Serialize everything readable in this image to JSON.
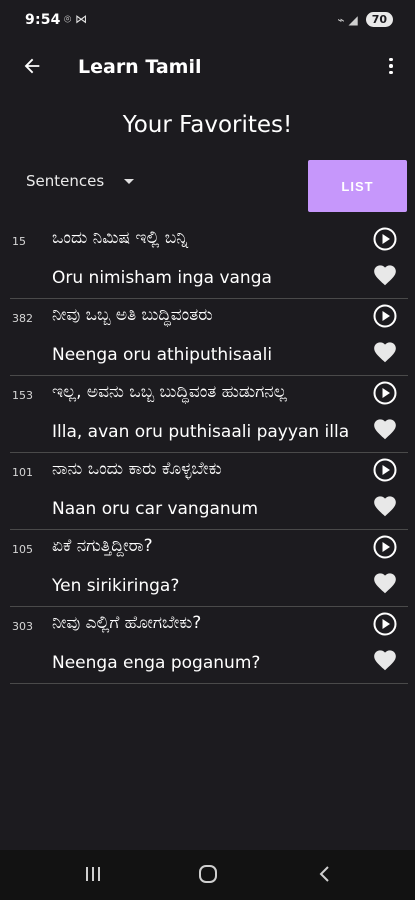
{
  "status_bar": {
    "time": "9:54",
    "left_icons": "⌾ ⋈",
    "signal_icons": "⌁ ◢",
    "battery": "70"
  },
  "app_bar": {
    "title": "Learn Tamil"
  },
  "page": {
    "title": "Your Favorites!",
    "category": "Sentences",
    "list_button": "LIST"
  },
  "items": [
    {
      "num": "15",
      "kannada": "ಒಂದು ನಿಮಿಷ ಇಲ್ಲಿ ಬನ್ನಿ",
      "english": "Oru nimisham inga vanga"
    },
    {
      "num": "382",
      "kannada": "ನೀವು ಒಬ್ಬ ಅತಿ ಬುದ್ಧಿವಂತರು",
      "english": "Neenga oru athiputhisaali"
    },
    {
      "num": "153",
      "kannada": "ಇಲ್ಲ, ಅವನು ಒಬ್ಬ ಬುದ್ಧಿವಂತ ಹುಡುಗನಲ್ಲ",
      "english": "Illa, avan oru puthisaali payyan illa"
    },
    {
      "num": "101",
      "kannada": "ನಾನು ಒಂದು ಕಾರು ಕೊಳ್ಳಬೇಕು",
      "english": "Naan oru car vanganum"
    },
    {
      "num": "105",
      "kannada": "ಏಕೆ ನಗುತ್ತಿದ್ದೀರಾ?",
      "english": "Yen sirikiringa?"
    },
    {
      "num": "303",
      "kannada": "ನೀವು ಎಲ್ಲಿಗೆ ಹೋಗಬೇಕು?",
      "english": "Neenga enga poganum?"
    }
  ],
  "colors": {
    "background": "#1c1b1f",
    "accent": "#c697fb",
    "divider": "#4a4a4a"
  }
}
